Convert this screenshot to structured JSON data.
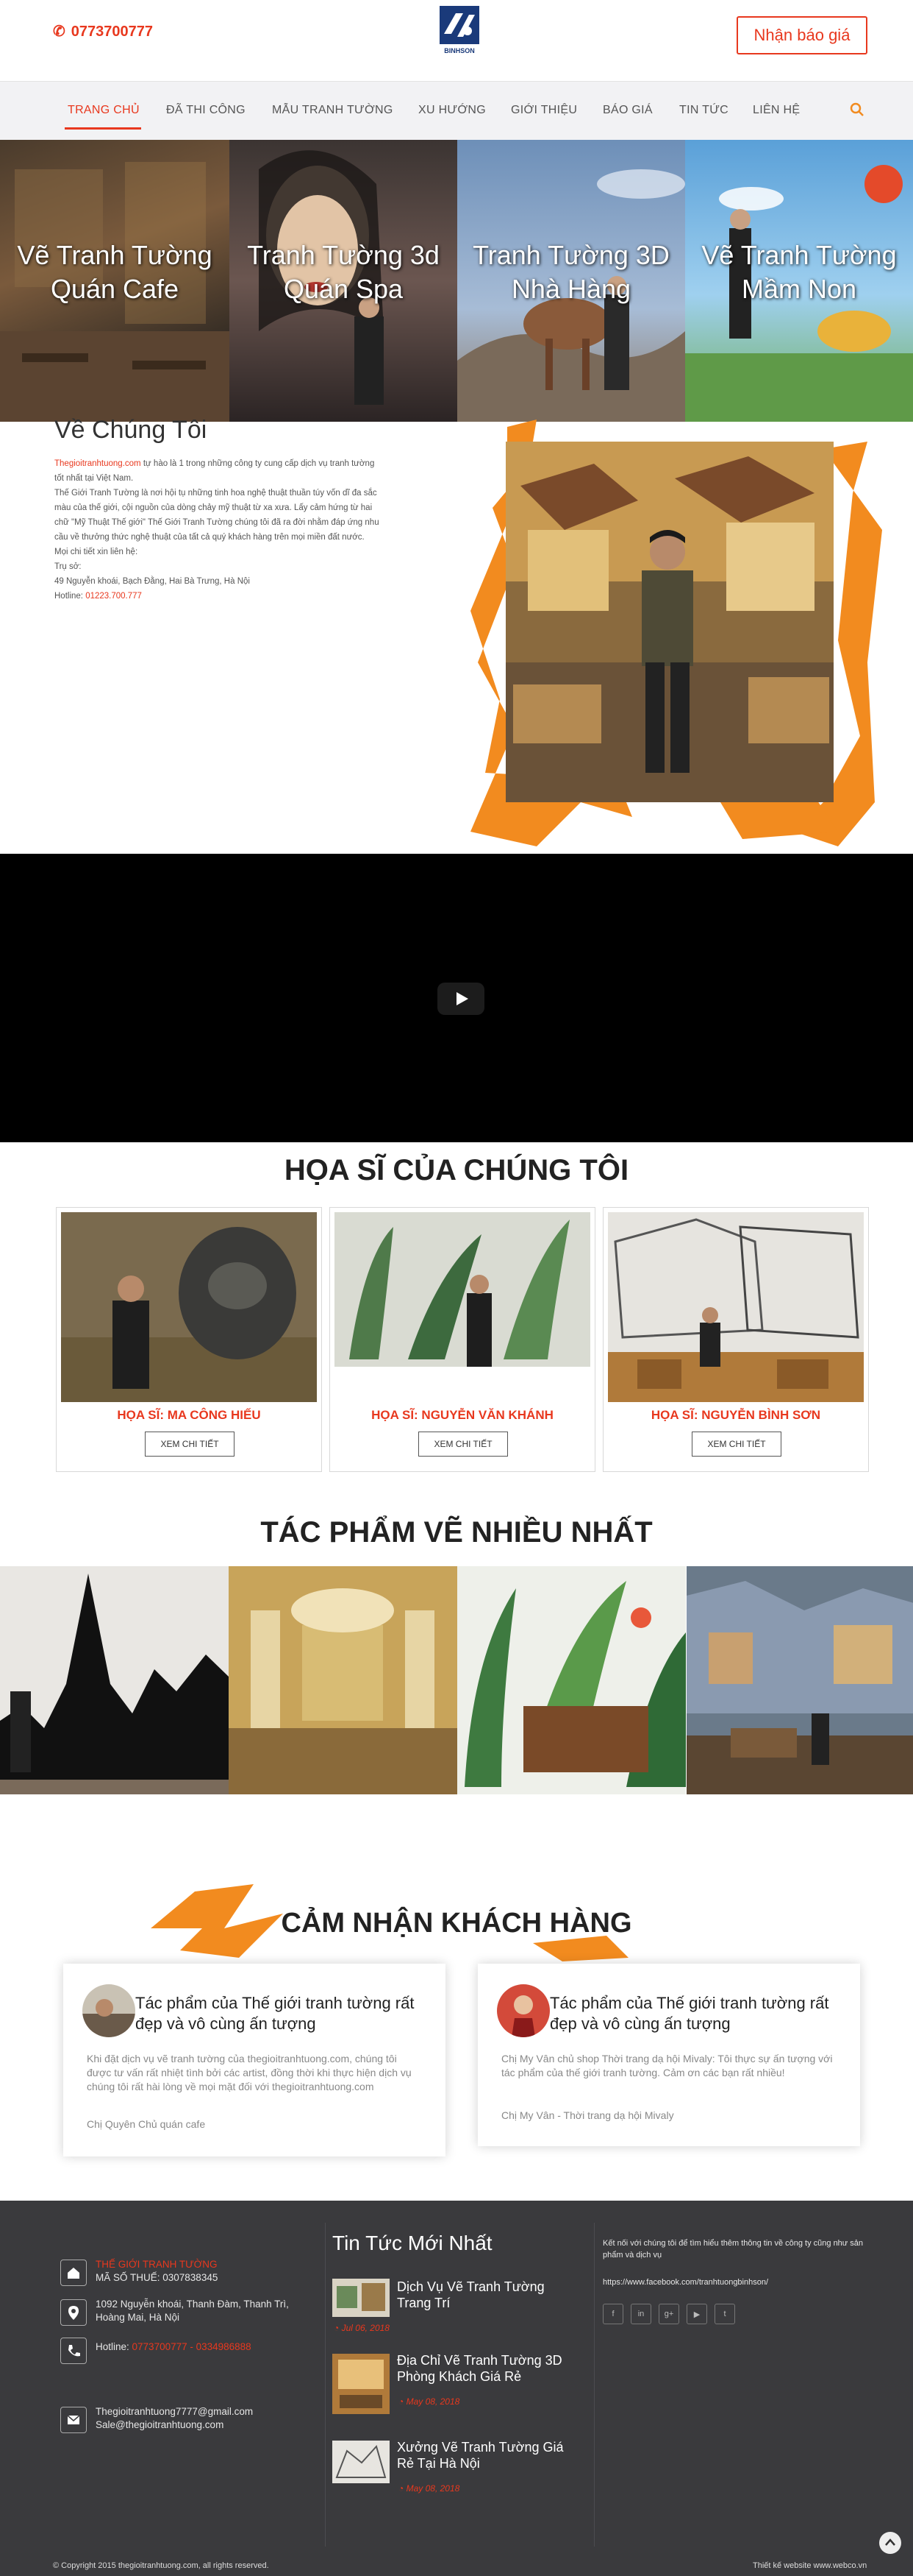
{
  "header": {
    "phone": "0773700777",
    "logo_text": "BINHSON",
    "quote_button": "Nhận báo giá"
  },
  "nav": {
    "items": [
      "TRANG CHỦ",
      "ĐÃ THI CÔNG",
      "MẪU TRANH TƯỜNG",
      "XU HƯỚNG",
      "GIỚI THIỆU",
      "BÁO GIÁ",
      "TIN TỨC",
      "LIÊN HỆ"
    ],
    "active": "TRANG CHỦ"
  },
  "banners": [
    {
      "caption": "Vẽ Tranh Tường Quán Cafe"
    },
    {
      "caption": "Tranh Tường 3d Quán Spa"
    },
    {
      "caption": "Tranh Tường 3D Nhà Hàng"
    },
    {
      "caption": "Vẽ Tranh Tường Mầm Non"
    }
  ],
  "about": {
    "title": "Về Chúng Tôi",
    "site": "Thegioitranhtuong.com",
    "intro": " tự hào là 1 trong những công ty cung cấp dịch vụ tranh tường tốt nhất tại Việt Nam.",
    "paragraph": "Thế Giới Tranh Tường là nơi hội tụ những tinh hoa nghệ thuật thuần túy vốn dĩ đa sắc màu của thế giới, cội nguồn của dòng chảy mỹ thuật từ xa xưa. Lấy cảm hứng từ hai chữ \"Mỹ Thuật Thế giới\" Thế Giới Tranh Tường chúng tôi đã ra đời nhằm đáp ứng nhu cầu về thưởng thức nghệ thuật của tất cả quý khách hàng trên mọi miền đất nước.",
    "contact_note": "Mọi chi tiết xin liên hệ:",
    "office_label": "Trụ sở:",
    "address": "49 Nguyễn khoái, Bạch Đằng, Hai Bà Trưng, Hà Nội",
    "hotline_label": "Hotline: ",
    "hotline": "01223.700.777"
  },
  "artists": {
    "title": "HỌA SĨ CỦA CHÚNG TÔI",
    "items": [
      {
        "name": "HỌA SĨ: MA CÔNG HIẾU",
        "button": "XEM CHI TIẾT"
      },
      {
        "name": "HỌA SĨ: NGUYỄN VĂN KHÁNH",
        "button": "XEM CHI TIẾT"
      },
      {
        "name": "HỌA SĨ: NGUYỄN BÌNH SƠN",
        "button": "XEM CHI TIẾT"
      }
    ]
  },
  "works": {
    "title": "TÁC PHẨM VẼ NHIỀU NHẤT"
  },
  "testimonials": {
    "title": "CẢM NHẬN KHÁCH HÀNG",
    "items": [
      {
        "heading": "Tác phẩm của Thế giới tranh tường rất đẹp và vô cùng ấn tượng",
        "text": "Khi đặt dịch vụ vẽ tranh tường của thegioitranhtuong.com, chúng tôi được tư vấn rất nhiệt tình bởi các artist, đồng thời khi thực hiện dịch vụ chúng tôi rất hài lòng về mọi mặt đối với thegioitranhtuong.com",
        "author": "Chị Quyên Chủ quán cafe"
      },
      {
        "heading": "Tác phẩm của Thế giới tranh tường rất đẹp và vô cùng ấn tượng",
        "text": "Chị My Vân chủ shop Thời trang dạ hội Mivaly: Tôi thực sự ấn tượng với tác phẩm của thế giới tranh tường. Cảm ơn các bạn rất nhiều!",
        "author": "Chị My Vân - Thời trang dạ hội Mivaly"
      }
    ]
  },
  "footer": {
    "company": "THẾ GIỚI TRANH TƯỜNG",
    "tax": "MÃ SỐ THUẾ: 0307838345",
    "address": "1092 Nguyễn khoái, Thanh Đàm, Thanh Trì, Hoàng Mai, Hà Nội",
    "hotline_label": "Hotline: ",
    "hotline": "0773700777 - 0334986888",
    "email1": "Thegioitranhtuong7777@gmail.com",
    "email2": "Sale@thegioitranhtuong.com",
    "news_title": "Tin Tức Mới Nhất",
    "news": [
      {
        "title": "Dịch Vụ Vẽ Tranh Tường Trang Trí",
        "date": "Jul 06, 2018"
      },
      {
        "title": "Địa Chỉ Vẽ Tranh Tường 3D Phòng Khách Giá Rẻ",
        "date": "May 08, 2018"
      },
      {
        "title": "Xưởng Vẽ Tranh Tường Giá Rẻ Tại Hà Nội",
        "date": "May 08, 2018"
      }
    ],
    "social_text": "Kết nối với chúng tôi để tìm hiểu thêm thông tin về công ty cũng như sản phẩm và dịch vụ",
    "facebook_url": "https://www.facebook.com/tranhtuongbinhson/",
    "social_icons": [
      "facebook-icon",
      "linkedin-icon",
      "google-plus-icon",
      "youtube-icon",
      "twitter-icon"
    ],
    "social_glyphs": [
      "f",
      "in",
      "g+",
      "▶",
      "t"
    ],
    "copyright": "© Copyright 2015 thegioitranhtuong.com, all rights reserved.",
    "credit": "Thiết kế website www.webco.vn"
  },
  "colors": {
    "accent": "#e8381e",
    "orange_splash": "#f28b1f",
    "footer_bg": "#3a3a3d"
  }
}
